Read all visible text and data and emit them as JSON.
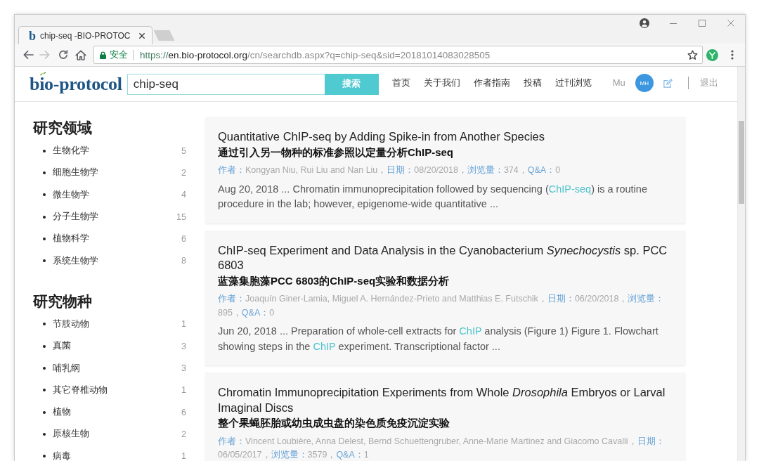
{
  "tabs": [
    {
      "favicon": "b",
      "title": "chip-seq -BIO-PROTOC",
      "selected": true
    }
  ],
  "toolbar": {
    "back_disabled": false,
    "forward_disabled": true
  },
  "address_bar": {
    "security_label": "安全",
    "url": {
      "scheme": "https://",
      "host": "en.bio-protocol.org",
      "path": "/cn/searchdb.aspx?q=chip-seq&sid=20181014083028505"
    }
  },
  "header": {
    "logo": "bio-protocol",
    "search": {
      "value": "chip-seq",
      "button": "搜索"
    },
    "nav": [
      "首页",
      "关于我们",
      "作者指南",
      "投稿",
      "过刊浏览"
    ],
    "user": {
      "name": "Mu",
      "avatar_initials": "MH"
    },
    "logout": "退出"
  },
  "sidebar": {
    "sections": [
      {
        "heading": "研究领域",
        "items": [
          {
            "label": "生物化学",
            "count": "5"
          },
          {
            "label": "细胞生物学",
            "count": "2"
          },
          {
            "label": "微生物学",
            "count": "4"
          },
          {
            "label": "分子生物学",
            "count": "15"
          },
          {
            "label": "植物科学",
            "count": "6"
          },
          {
            "label": "系统生物学",
            "count": "8"
          }
        ]
      },
      {
        "heading": "研究物种",
        "items": [
          {
            "label": "节肢动物",
            "count": "1"
          },
          {
            "label": "真菌",
            "count": "3"
          },
          {
            "label": "哺乳纲",
            "count": "3"
          },
          {
            "label": "其它脊椎动物",
            "count": "1"
          },
          {
            "label": "植物",
            "count": "6"
          },
          {
            "label": "原核生物",
            "count": "2"
          },
          {
            "label": "病毒",
            "count": "1"
          }
        ]
      }
    ]
  },
  "results": [
    {
      "title": "Quantitative ChIP-seq by Adding Spike-in from Another Species",
      "title_zh": "通过引入另一物种的标准参照以定量分析ChIP-seq",
      "meta": [
        {
          "kind": "label",
          "text": "作者："
        },
        {
          "kind": "value",
          "text": "Kongyan Niu, Rui Liu and Nan Liu，"
        },
        {
          "kind": "label",
          "text": "日期："
        },
        {
          "kind": "value",
          "text": "08/20/2018，"
        },
        {
          "kind": "label",
          "text": "浏览量："
        },
        {
          "kind": "value",
          "text": "374，"
        },
        {
          "kind": "label",
          "text": "Q&A："
        },
        {
          "kind": "value",
          "text": "0"
        }
      ],
      "snippet": [
        {
          "highlight": false,
          "text": "Aug 20, 2018 ... Chromatin immunoprecipitation followed by sequencing ("
        },
        {
          "highlight": true,
          "text": "ChIP-seq"
        },
        {
          "highlight": false,
          "text": ") is a routine procedure in the lab; however, epigenome-wide quantitative ..."
        }
      ]
    },
    {
      "title": "ChIP-seq Experiment and Data Analysis in the Cyanobacterium *Synechocystis* sp. PCC 6803",
      "title_zh": "蓝藻集胞藻PCC 6803的ChIP-seq实验和数据分析",
      "meta": [
        {
          "kind": "label",
          "text": "作者："
        },
        {
          "kind": "value",
          "text": "Joaquín Giner-Lamia, Miguel A. Hernández-Prieto and Matthias E. Futschik，"
        },
        {
          "kind": "label",
          "text": "日期："
        },
        {
          "kind": "value",
          "text": "06/20/2018，"
        },
        {
          "kind": "label",
          "text": "浏览量："
        },
        {
          "kind": "value",
          "text": "895，"
        },
        {
          "kind": "label",
          "text": "Q&A："
        },
        {
          "kind": "value",
          "text": "0"
        }
      ],
      "snippet": [
        {
          "highlight": false,
          "text": "Jun 20, 2018 ... Preparation of whole-cell extracts for "
        },
        {
          "highlight": true,
          "text": "ChIP"
        },
        {
          "highlight": false,
          "text": " analysis (Figure 1) Figure 1. Flowchart showing steps in the "
        },
        {
          "highlight": true,
          "text": "ChIP"
        },
        {
          "highlight": false,
          "text": " experiment. Transcriptional factor ..."
        }
      ]
    },
    {
      "title": "Chromatin Immunoprecipitation Experiments from Whole *Drosophila* Embryos or Larval Imaginal Discs",
      "title_zh": "整个果蝇胚胎或幼虫成虫盘的染色质免疫沉淀实验",
      "meta": [
        {
          "kind": "label",
          "text": "作者："
        },
        {
          "kind": "value",
          "text": "Vincent Loubière, Anna Delest, Bernd Schuettengruber, Anne-Marie Martinez and Giacomo Cavalli，"
        },
        {
          "kind": "label",
          "text": "日期："
        },
        {
          "kind": "value",
          "text": "06/05/2017，"
        },
        {
          "kind": "label",
          "text": "浏览量："
        },
        {
          "kind": "value",
          "text": "3579，"
        },
        {
          "kind": "label",
          "text": "Q&A："
        },
        {
          "kind": "value",
          "text": "1"
        }
      ]
    }
  ]
}
